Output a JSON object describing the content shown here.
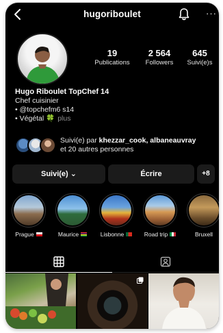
{
  "header": {
    "username": "hugoriboulet",
    "more": "···"
  },
  "stats": {
    "posts_count": "19",
    "posts_label": "Publications",
    "followers_count": "2 564",
    "followers_label": "Followers",
    "following_count": "645",
    "following_label": "Suivi(e)s"
  },
  "bio": {
    "name": "Hugo Riboulet TopChef 14",
    "line1": "Chef cuisinier",
    "line2": "• @topchefm6 s14",
    "line3": "• Végétal 🍀",
    "more": "plus"
  },
  "mutual": {
    "prefix": "Suivi(e) par ",
    "names": "khezzar_cook, albaneauvray",
    "suffix": "et 20 autres personnes"
  },
  "actions": {
    "follow_label": "Suivi(e) ⌄",
    "write_label": "Écrire",
    "add_user_label": "+8"
  },
  "highlights": [
    {
      "label": "Prague",
      "flag": "cz"
    },
    {
      "label": "Maurice",
      "flag": "mu"
    },
    {
      "label": "Lisbonne",
      "flag": "pt"
    },
    {
      "label": "Road trip",
      "flag": "it"
    },
    {
      "label": "Bruxell",
      "flag": ""
    }
  ],
  "colors": {
    "background": "#000000",
    "button": "#1b1b1b",
    "muted": "#8e8e8e"
  },
  "icons": [
    "back-arrow-icon",
    "bell-icon",
    "more-dots-icon",
    "add-person-icon",
    "grid-icon",
    "tagged-icon",
    "multiple-posts-icon"
  ]
}
